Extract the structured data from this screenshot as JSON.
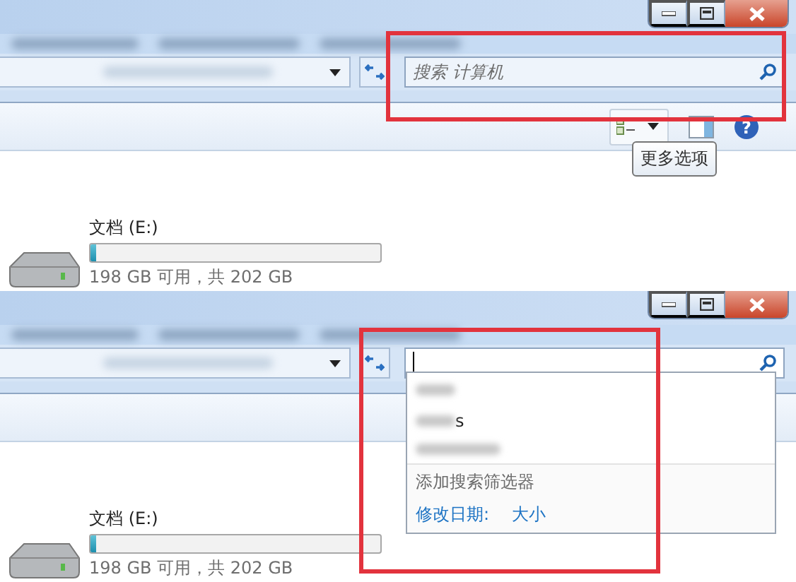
{
  "panels": [
    {
      "search": {
        "placeholder": "搜索 计算机",
        "focused": false
      },
      "help": "?",
      "tooltip": "更多选项",
      "drive": {
        "name": "文档 (E:)",
        "level": 0.02,
        "space": "198 GB 可用，共 202 GB"
      }
    },
    {
      "search": {
        "focused": true
      },
      "dropdown": {
        "history": [
          {
            "kind": "blurred"
          },
          {
            "kind": "blurred",
            "text": "s"
          },
          {
            "kind": "blurred"
          }
        ],
        "filter_heading": "添加搜索筛选器",
        "filters": [
          "修改日期:",
          "大小"
        ]
      },
      "drive": {
        "name": "文档 (E:)",
        "level": 0.02,
        "space": "198 GB 可用，共 202 GB"
      }
    }
  ]
}
